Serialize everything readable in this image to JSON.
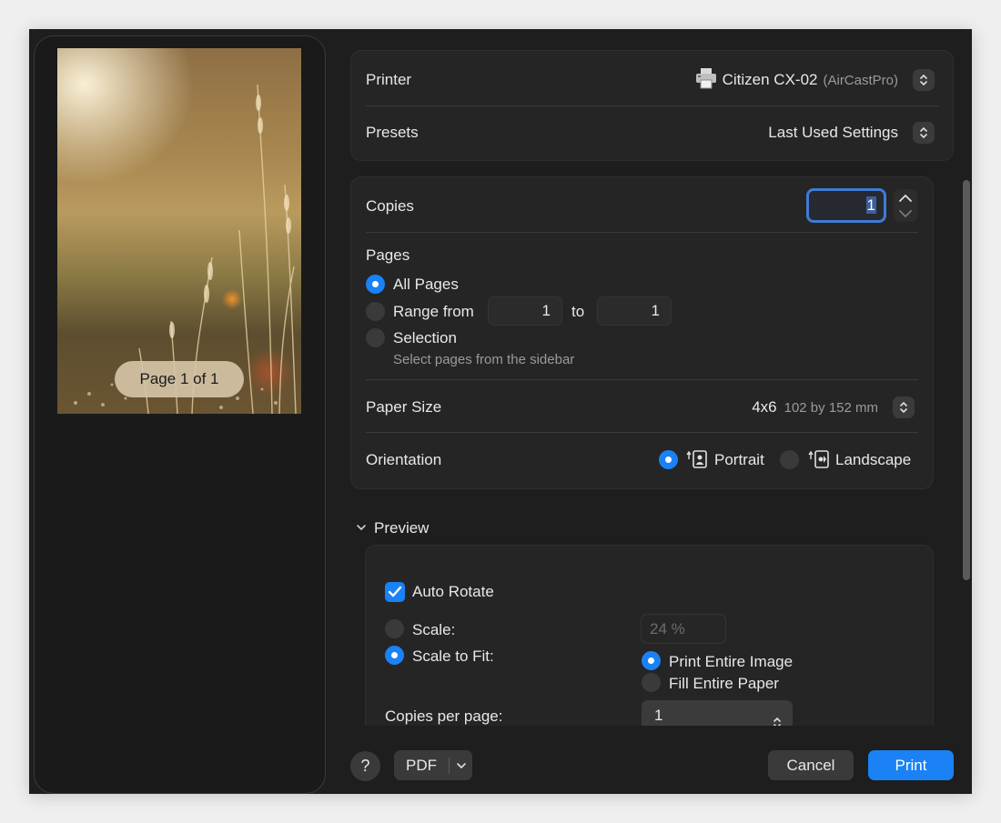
{
  "preview_sidebar": {
    "page_indicator": "Page 1 of 1"
  },
  "printer": {
    "label": "Printer",
    "name": "Citizen CX-02",
    "detail": "(AirCastPro)"
  },
  "presets": {
    "label": "Presets",
    "value": "Last Used Settings"
  },
  "copies": {
    "label": "Copies",
    "value": "1"
  },
  "pages": {
    "label": "Pages",
    "all_pages": "All Pages",
    "range_from": "Range from",
    "range_start": "1",
    "to": "to",
    "range_end": "1",
    "selection": "Selection",
    "selection_hint": "Select pages from the sidebar",
    "selected": "All Pages"
  },
  "paper_size": {
    "label": "Paper Size",
    "value": "4x6",
    "detail": "102 by 152 mm"
  },
  "orientation": {
    "label": "Orientation",
    "portrait": "Portrait",
    "landscape": "Landscape",
    "selected": "Portrait"
  },
  "preview_section": {
    "title": "Preview",
    "auto_rotate": "Auto Rotate",
    "scale": "Scale:",
    "scale_value": "24 %",
    "scale_to_fit": "Scale to Fit:",
    "print_entire_image": "Print Entire Image",
    "fill_entire_paper": "Fill Entire Paper",
    "copies_per_page": "Copies per page:",
    "copies_per_page_value": "1"
  },
  "footer": {
    "help": "?",
    "pdf": "PDF",
    "cancel": "Cancel",
    "print": "Print"
  },
  "colors": {
    "accent": "#1a82f5",
    "background": "#1e1e1e",
    "card": "#252525"
  }
}
